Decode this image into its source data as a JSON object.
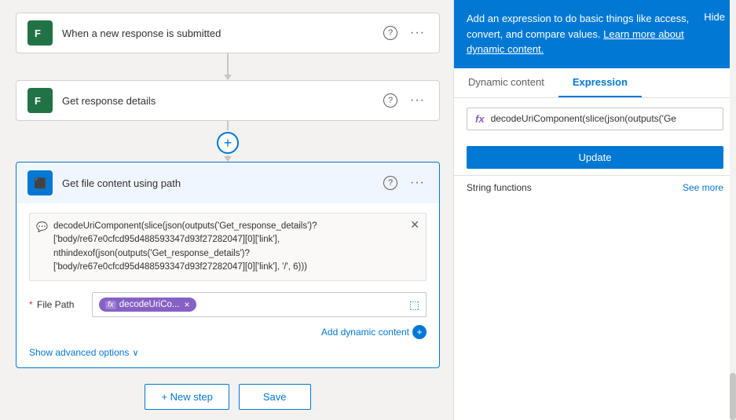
{
  "steps": [
    {
      "id": "step1",
      "title": "When a new response is submitted",
      "icon_type": "forms",
      "active": false
    },
    {
      "id": "step2",
      "title": "Get response details",
      "icon_type": "forms",
      "active": false
    },
    {
      "id": "step3",
      "title": "Get file content using path",
      "icon_type": "onedrive",
      "active": true,
      "expression_code": "decodeUriComponent(slice(json(outputs('Get_response_details')?['body/re67e0cfcd95d488593347d93f27282047][0]['link'], nthindexof(json(outputs('Get_response_details')?['body/re67e0cfcd95d488593347d93f27282047][0]['link'], '/', 6)))",
      "file_path_token": "decodeUriCo...",
      "show_advanced_label": "Show advanced options"
    }
  ],
  "buttons": {
    "new_step": "+ New step",
    "save": "Save"
  },
  "right_panel": {
    "header_text": "Add an expression to do basic things like access, convert, and compare values.",
    "learn_more_text": "Learn more about dynamic content.",
    "hide_label": "Hide",
    "tabs": [
      "Dynamic content",
      "Expression"
    ],
    "active_tab": "Expression",
    "expression_value": "decodeUriComponent(slice(json(outputs('Ge",
    "update_button": "Update",
    "section_title": "String functions",
    "see_more": "See more"
  },
  "icons": {
    "question_mark": "?",
    "ellipsis": "···",
    "plus": "+",
    "close": "✕",
    "chevron_down": "∨",
    "fx": "fx"
  },
  "colors": {
    "primary": "#0078d4",
    "forms_green": "#217346",
    "onedrive_blue": "#0078d4",
    "expression_purple": "#8661c5"
  }
}
